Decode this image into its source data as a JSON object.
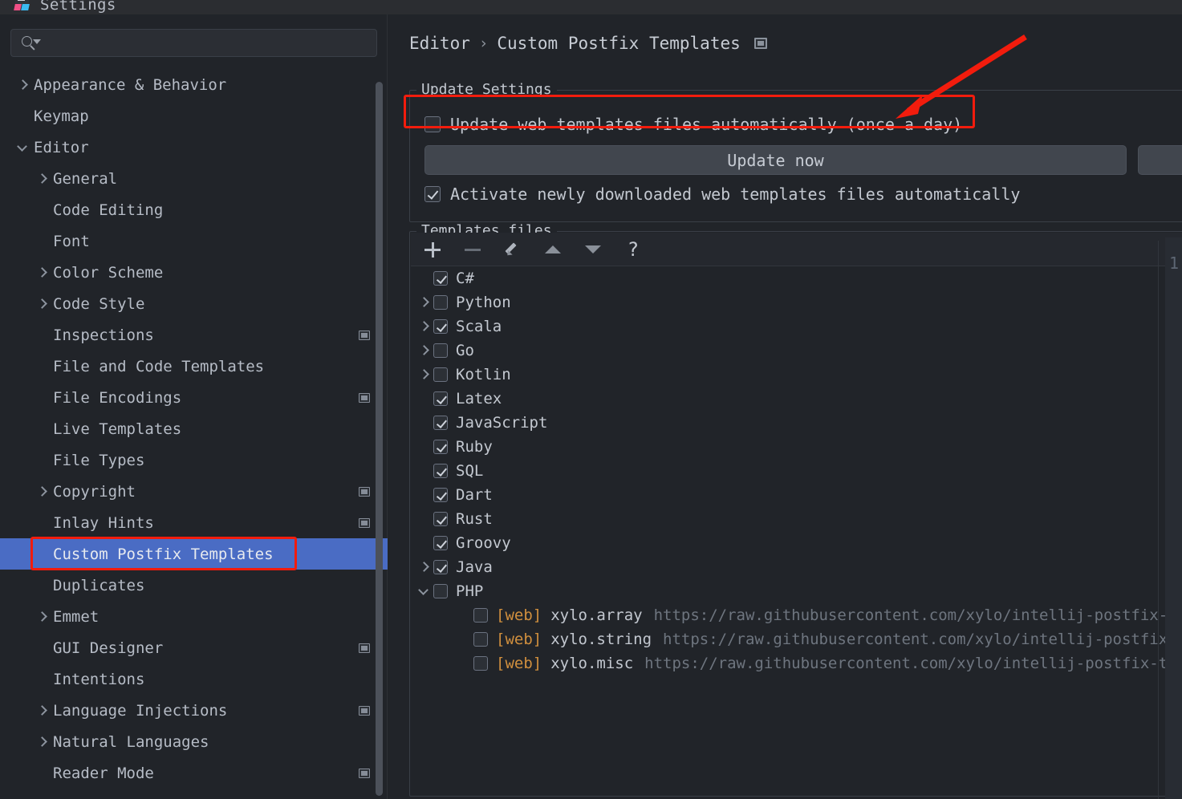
{
  "window": {
    "title": "Settings",
    "icon": "intellij-idea-icon"
  },
  "search": {
    "value": "",
    "placeholder": "",
    "icon": "search-icon"
  },
  "sidebar": {
    "items": [
      {
        "label": "Appearance & Behavior",
        "indent": 0,
        "arrow": "right",
        "badge": false,
        "selected": false
      },
      {
        "label": "Keymap",
        "indent": 0,
        "arrow": "none",
        "badge": false,
        "selected": false
      },
      {
        "label": "Editor",
        "indent": 0,
        "arrow": "down",
        "badge": false,
        "selected": false
      },
      {
        "label": "General",
        "indent": 1,
        "arrow": "right",
        "badge": false,
        "selected": false
      },
      {
        "label": "Code Editing",
        "indent": 1,
        "arrow": "none",
        "badge": false,
        "selected": false
      },
      {
        "label": "Font",
        "indent": 1,
        "arrow": "none",
        "badge": false,
        "selected": false
      },
      {
        "label": "Color Scheme",
        "indent": 1,
        "arrow": "right",
        "badge": false,
        "selected": false
      },
      {
        "label": "Code Style",
        "indent": 1,
        "arrow": "right",
        "badge": false,
        "selected": false
      },
      {
        "label": "Inspections",
        "indent": 1,
        "arrow": "none",
        "badge": true,
        "selected": false
      },
      {
        "label": "File and Code Templates",
        "indent": 1,
        "arrow": "none",
        "badge": false,
        "selected": false
      },
      {
        "label": "File Encodings",
        "indent": 1,
        "arrow": "none",
        "badge": true,
        "selected": false
      },
      {
        "label": "Live Templates",
        "indent": 1,
        "arrow": "none",
        "badge": false,
        "selected": false
      },
      {
        "label": "File Types",
        "indent": 1,
        "arrow": "none",
        "badge": false,
        "selected": false
      },
      {
        "label": "Copyright",
        "indent": 1,
        "arrow": "right",
        "badge": true,
        "selected": false
      },
      {
        "label": "Inlay Hints",
        "indent": 1,
        "arrow": "none",
        "badge": true,
        "selected": false
      },
      {
        "label": "Custom Postfix Templates",
        "indent": 1,
        "arrow": "none",
        "badge": false,
        "selected": true
      },
      {
        "label": "Duplicates",
        "indent": 1,
        "arrow": "none",
        "badge": false,
        "selected": false
      },
      {
        "label": "Emmet",
        "indent": 1,
        "arrow": "right",
        "badge": false,
        "selected": false
      },
      {
        "label": "GUI Designer",
        "indent": 1,
        "arrow": "none",
        "badge": true,
        "selected": false
      },
      {
        "label": "Intentions",
        "indent": 1,
        "arrow": "none",
        "badge": false,
        "selected": false
      },
      {
        "label": "Language Injections",
        "indent": 1,
        "arrow": "right",
        "badge": true,
        "selected": false
      },
      {
        "label": "Natural Languages",
        "indent": 1,
        "arrow": "right",
        "badge": false,
        "selected": false
      },
      {
        "label": "Reader Mode",
        "indent": 1,
        "arrow": "none",
        "badge": true,
        "selected": false
      }
    ]
  },
  "breadcrumb": {
    "parent": "Editor",
    "separator": "›",
    "current": "Custom Postfix Templates",
    "icon": "settings-page-icon"
  },
  "update_settings": {
    "legend": "Update Settings",
    "auto_update": {
      "label": "Update web templates files automatically (once a day)",
      "checked": false
    },
    "update_now_button": "Update now",
    "activate_new": {
      "label": "Activate newly downloaded web templates files automatically",
      "checked": true
    }
  },
  "templates_files": {
    "legend": "Templates files",
    "toolbar": [
      {
        "name": "add-button",
        "glyph": "+",
        "enabled": true
      },
      {
        "name": "remove-button",
        "glyph": "−",
        "enabled": false
      },
      {
        "name": "edit-button",
        "glyph": "pencil",
        "enabled": true
      },
      {
        "name": "move-up-button",
        "glyph": "▲",
        "enabled": true
      },
      {
        "name": "move-down-button",
        "glyph": "▼",
        "enabled": true
      },
      {
        "name": "help-button",
        "glyph": "?",
        "enabled": true
      }
    ],
    "rows": [
      {
        "label": "C#",
        "checked": true,
        "arrow": "none",
        "indent": 0,
        "tag": "",
        "url": ""
      },
      {
        "label": "Python",
        "checked": false,
        "arrow": "right",
        "indent": 0,
        "tag": "",
        "url": ""
      },
      {
        "label": "Scala",
        "checked": true,
        "arrow": "right",
        "indent": 0,
        "tag": "",
        "url": ""
      },
      {
        "label": "Go",
        "checked": false,
        "arrow": "right",
        "indent": 0,
        "tag": "",
        "url": ""
      },
      {
        "label": "Kotlin",
        "checked": false,
        "arrow": "right",
        "indent": 0,
        "tag": "",
        "url": ""
      },
      {
        "label": "Latex",
        "checked": true,
        "arrow": "none",
        "indent": 0,
        "tag": "",
        "url": ""
      },
      {
        "label": "JavaScript",
        "checked": true,
        "arrow": "none",
        "indent": 0,
        "tag": "",
        "url": ""
      },
      {
        "label": "Ruby",
        "checked": true,
        "arrow": "none",
        "indent": 0,
        "tag": "",
        "url": ""
      },
      {
        "label": "SQL",
        "checked": true,
        "arrow": "none",
        "indent": 0,
        "tag": "",
        "url": ""
      },
      {
        "label": "Dart",
        "checked": true,
        "arrow": "none",
        "indent": 0,
        "tag": "",
        "url": ""
      },
      {
        "label": "Rust",
        "checked": true,
        "arrow": "none",
        "indent": 0,
        "tag": "",
        "url": ""
      },
      {
        "label": "Groovy",
        "checked": true,
        "arrow": "none",
        "indent": 0,
        "tag": "",
        "url": ""
      },
      {
        "label": "Java",
        "checked": true,
        "arrow": "right",
        "indent": 0,
        "tag": "",
        "url": ""
      },
      {
        "label": "PHP",
        "checked": false,
        "arrow": "down",
        "indent": 0,
        "tag": "",
        "url": ""
      },
      {
        "label": "xylo.array",
        "checked": false,
        "arrow": "none",
        "indent": 1,
        "tag": "[web]",
        "url": "https://raw.githubusercontent.com/xylo/intellij-postfix-templa"
      },
      {
        "label": "xylo.string",
        "checked": false,
        "arrow": "none",
        "indent": 1,
        "tag": "[web]",
        "url": "https://raw.githubusercontent.com/xylo/intellij-postfix-templ"
      },
      {
        "label": "xylo.misc",
        "checked": false,
        "arrow": "none",
        "indent": 1,
        "tag": "[web]",
        "url": "https://raw.githubusercontent.com/xylo/intellij-postfix-template"
      }
    ]
  },
  "background_editor": {
    "line_number": "1"
  },
  "annotations": {
    "color": "#f21c0d",
    "boxes": [
      "sidebar-selected-item",
      "auto-update-checkbox-row"
    ],
    "arrow": "points-to-auto-update-checkbox"
  }
}
